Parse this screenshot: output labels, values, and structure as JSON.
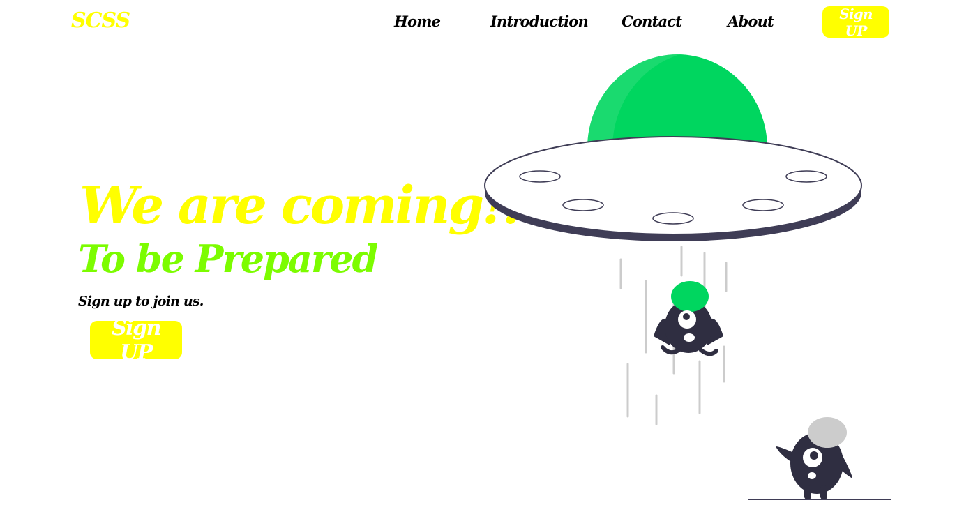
{
  "colors": {
    "accent": "#ffff00",
    "secondary": "#7cfc00",
    "ufo_green": "#00d65f",
    "dark": "#2f2e41",
    "light_gray": "#cccccc"
  },
  "header": {
    "brand": "SCSS",
    "nav": {
      "home": "Home",
      "introduction": "Introduction",
      "contact": "Contact",
      "about": "About"
    },
    "signup_label": "Sign UP"
  },
  "hero": {
    "title": "We are coming!!",
    "subtitle": "To be Prepared",
    "text": "Sign up to join us.",
    "signup_label": "Sign UP"
  },
  "illustration": {
    "icons": [
      "ufo-icon",
      "alien-abducted-icon",
      "alien-standing-icon"
    ]
  }
}
